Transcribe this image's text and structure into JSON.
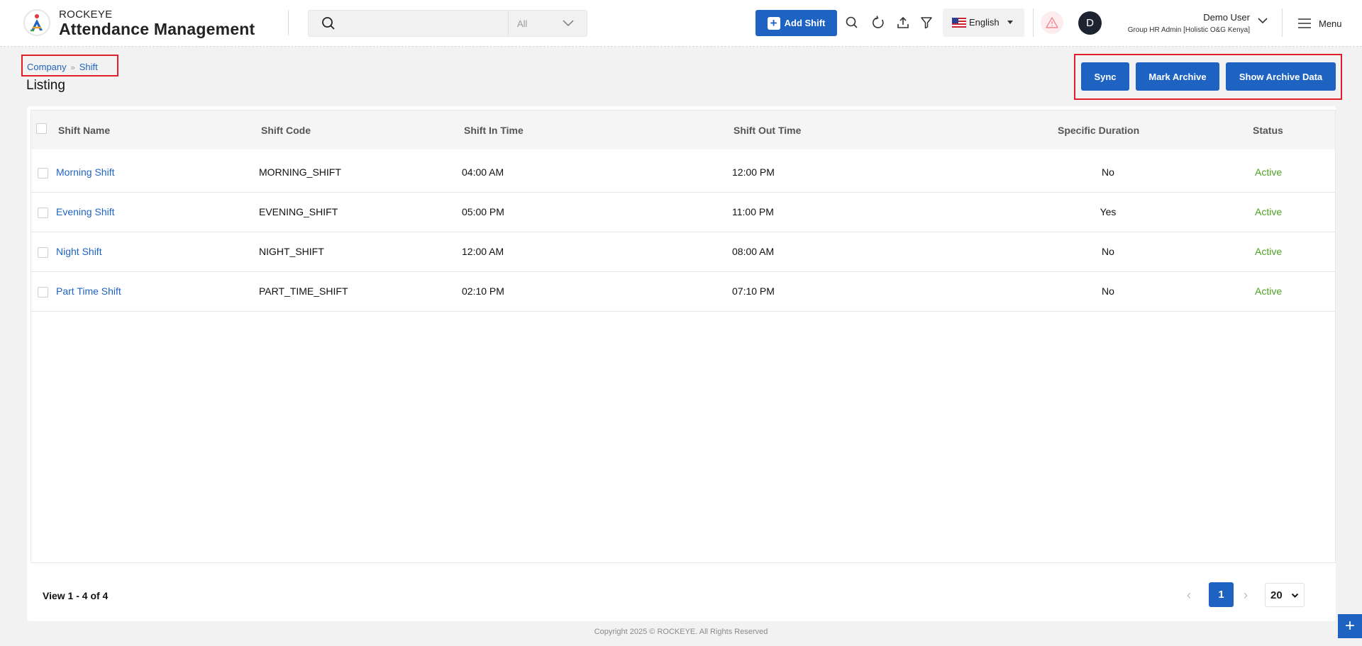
{
  "app": {
    "brand_top": "ROCKEYE",
    "brand_main": "Attendance Management"
  },
  "search": {
    "placeholder": "",
    "scope": "All"
  },
  "header": {
    "add_shift_label": "Add Shift",
    "language": "English",
    "user_initial": "D",
    "user_name": "Demo User",
    "user_role": "Group HR Admin [Holistic O&G Kenya]",
    "menu_label": "Menu"
  },
  "breadcrumb": {
    "items": [
      "Company",
      "Shift"
    ]
  },
  "page": {
    "title": "Listing"
  },
  "actions": {
    "sync": "Sync",
    "mark_archive": "Mark Archive",
    "show_archive": "Show Archive Data"
  },
  "table": {
    "columns": [
      "Shift Name",
      "Shift Code",
      "Shift In Time",
      "Shift Out Time",
      "Specific Duration",
      "Status"
    ],
    "rows": [
      {
        "name": "Morning Shift",
        "code": "MORNING_SHIFT",
        "in": "04:00 AM",
        "out": "12:00 PM",
        "specific": "No",
        "status": "Active"
      },
      {
        "name": "Evening Shift",
        "code": "EVENING_SHIFT",
        "in": "05:00 PM",
        "out": "11:00 PM",
        "specific": "Yes",
        "status": "Active"
      },
      {
        "name": "Night Shift",
        "code": "NIGHT_SHIFT",
        "in": "12:00 AM",
        "out": "08:00 AM",
        "specific": "No",
        "status": "Active"
      },
      {
        "name": "Part Time Shift",
        "code": "PART_TIME_SHIFT",
        "in": "02:10 PM",
        "out": "07:10 PM",
        "specific": "No",
        "status": "Active"
      }
    ]
  },
  "pagination": {
    "view_text": "View 1 - 4 of 4",
    "current_page": "1",
    "page_size": "20",
    "prev": "‹",
    "next": "›"
  },
  "footer": {
    "copyright": "Copyright 2025 © ROCKEYE. All Rights Reserved"
  },
  "fab": {
    "label": "+"
  },
  "colors": {
    "primary": "#1e63c1",
    "active_status": "#4ea122",
    "highlight_border": "#e01e2b"
  }
}
